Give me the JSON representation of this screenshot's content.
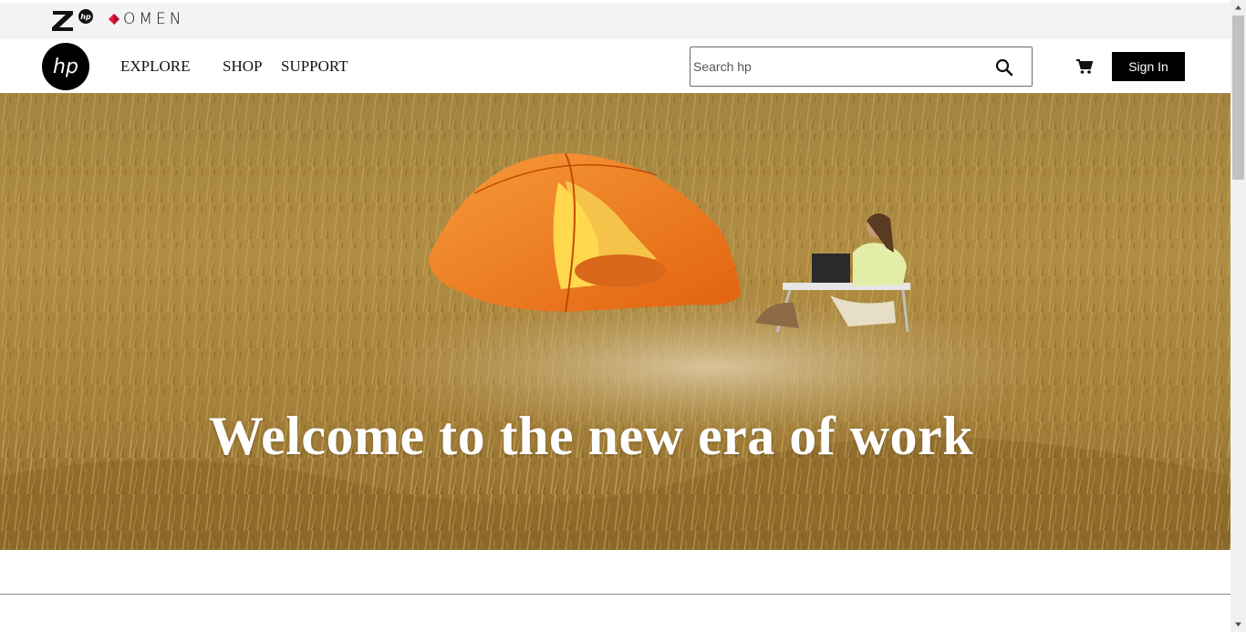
{
  "brands": {
    "z_logo_icon": "hp-z-logo-icon",
    "omen_label": "OMEN"
  },
  "nav": {
    "logo_icon": "hp-logo-icon",
    "links": [
      "EXPLORE",
      "SHOP",
      "SUPPORT"
    ]
  },
  "search": {
    "placeholder": "Search hp",
    "value": ""
  },
  "account": {
    "cart_icon": "cart-icon",
    "sign_in_label": "Sign In"
  },
  "hero": {
    "title": "Welcome to the new era of work"
  },
  "colors": {
    "topbar_bg": "#f3f3f3",
    "signin_bg": "#000000",
    "omen_accent": "#e8173f",
    "tent_orange": "#f07a1a"
  }
}
